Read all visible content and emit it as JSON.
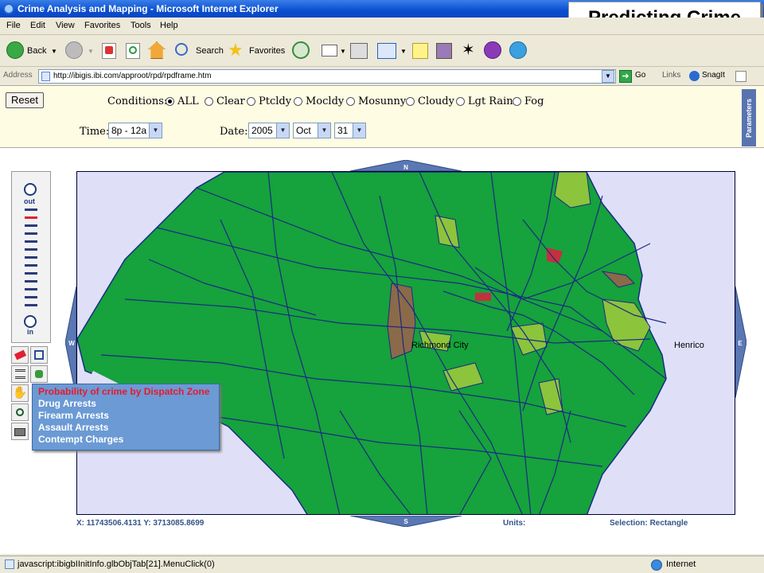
{
  "window": {
    "title": "Crime Analysis and Mapping - Microsoft Internet Explorer"
  },
  "overlay_title": "Predicting Crime",
  "menu": [
    "File",
    "Edit",
    "View",
    "Favorites",
    "Tools",
    "Help"
  ],
  "toolbar": {
    "back": "Back",
    "search": "Search",
    "favorites": "Favorites"
  },
  "address": {
    "label": "Address",
    "url": "http://ibigis.ibi.com/approot/rpd/rpdframe.htm",
    "go": "Go",
    "links": "Links",
    "snagit": "SnagIt"
  },
  "params": {
    "reset": "Reset",
    "conditions_label": "Conditions:",
    "conditions": [
      {
        "label": "ALL",
        "selected": true
      },
      {
        "label": "Clear",
        "selected": false
      },
      {
        "label": "Ptcldy",
        "selected": false
      },
      {
        "label": "Mocldy",
        "selected": false
      },
      {
        "label": "Mosunny",
        "selected": false
      },
      {
        "label": "Cloudy",
        "selected": false
      },
      {
        "label": "Lgt Rain",
        "selected": false
      },
      {
        "label": "Fog",
        "selected": false
      }
    ],
    "time_label": "Time:",
    "time_value": "8p - 12a",
    "date_label": "Date:",
    "year": "2005",
    "month": "Oct",
    "day": "31",
    "side_tab": "Parameters"
  },
  "zoom": {
    "out": "out",
    "in": "in"
  },
  "map": {
    "north": "N",
    "south": "S",
    "east": "E",
    "west": "W",
    "labels": {
      "city": "Richmond City",
      "county": "Henrico"
    },
    "colors": {
      "background": "#dfe0f8",
      "zone_green": "#16a23c",
      "zone_light": "#8cc43c",
      "zone_brown": "#8a6a48",
      "roads": "#1a2a86",
      "red": "#c43040"
    }
  },
  "layers": [
    "Probability of crime by Dispatch Zone",
    "Drug Arrests",
    "Firearm Arrests",
    "Assault Arrests",
    "Contempt Charges"
  ],
  "status_line": {
    "coords": "X: 11743506.4131  Y: 3713085.8699",
    "units": "Units:",
    "selection": "Selection: Rectangle"
  },
  "statusbar": {
    "text": "javascript:ibigbIInitInfo.glbObjTab[21].MenuClick(0)",
    "zone": "Internet"
  }
}
